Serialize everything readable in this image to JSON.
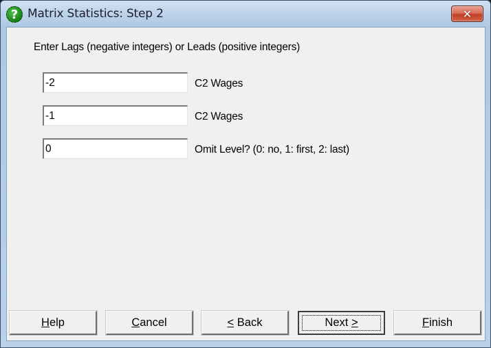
{
  "window": {
    "title": "Matrix Statistics: Step 2",
    "title_icon": "help-question-icon",
    "close_glyph": "✕"
  },
  "main": {
    "instruction": "Enter Lags (negative integers) or Leads (positive integers)",
    "fields": [
      {
        "value": "-2",
        "label": "C2 Wages"
      },
      {
        "value": "-1",
        "label": "C2 Wages"
      },
      {
        "value": "0",
        "label": "Omit Level? (0: no, 1: first, 2: last)"
      }
    ]
  },
  "buttons": {
    "help": {
      "mnemonic": "H",
      "rest": "elp"
    },
    "cancel": {
      "mnemonic": "C",
      "rest": "ancel"
    },
    "back": {
      "mnemonic": "<",
      "rest": " Back"
    },
    "next": {
      "pre": "Next ",
      "mnemonic": ">"
    },
    "finish": {
      "mnemonic": "F",
      "rest": "inish"
    }
  }
}
